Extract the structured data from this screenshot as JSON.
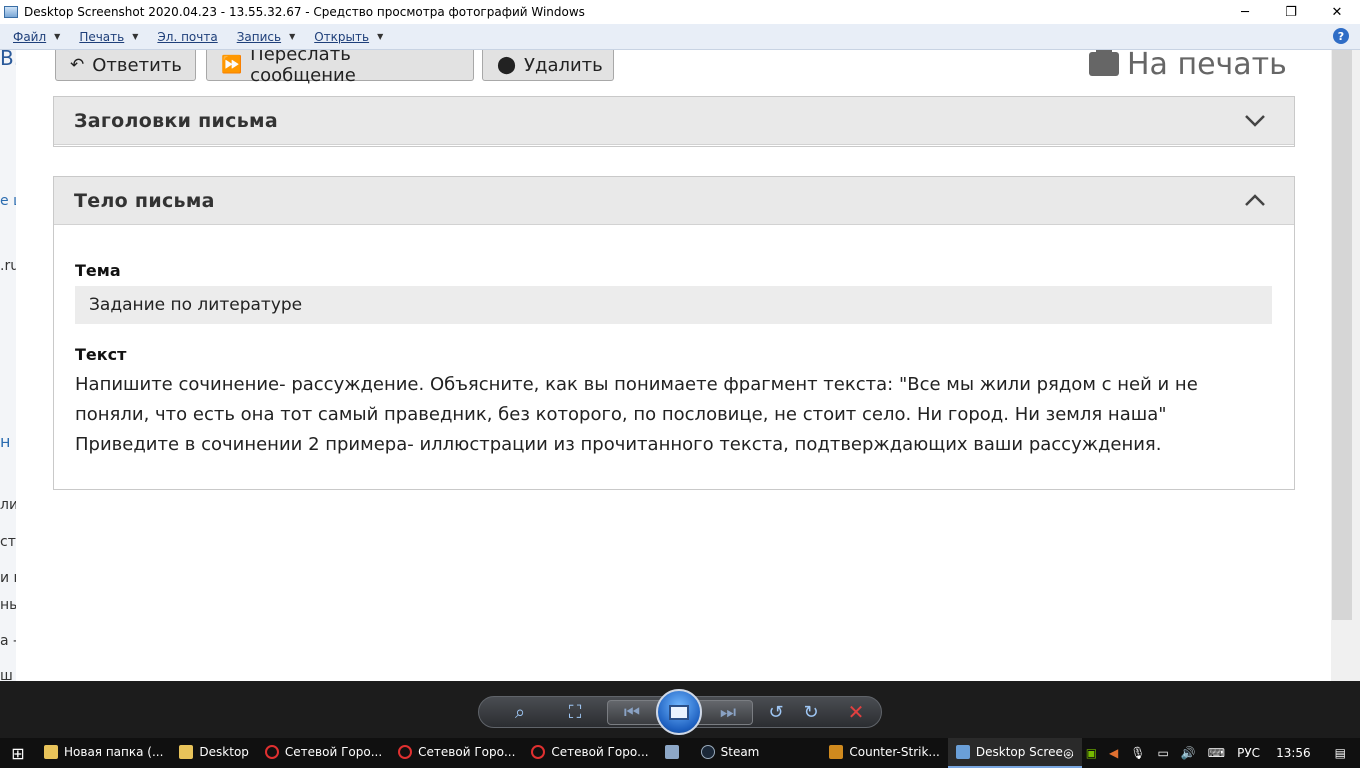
{
  "window": {
    "title": "Desktop Screenshot 2020.04.23 - 13.55.32.67 - Средство просмотра фотографий Windows",
    "controls": {
      "minimize": "─",
      "maximize": "❐",
      "close": "✕"
    }
  },
  "menu": [
    {
      "label": "Файл",
      "has_dropdown": true
    },
    {
      "label": "Печать",
      "has_dropdown": true
    },
    {
      "label": "Эл. почта",
      "has_dropdown": false
    },
    {
      "label": "Запись",
      "has_dropdown": true
    },
    {
      "label": "Открыть",
      "has_dropdown": true
    }
  ],
  "help": "?",
  "left_fragments": [
    "В.",
    "е ц",
    ".ru",
    "н",
    "ли",
    "ст",
    "и г",
    "нь",
    "а -",
    "ш"
  ],
  "email": {
    "actions": {
      "reply": "Ответить",
      "forward": "Переслать сообщение",
      "delete": "Удалить",
      "print": "На печать"
    },
    "headers_section": {
      "title": "Заголовки письма",
      "expanded": false
    },
    "body_section": {
      "title": "Тело письма",
      "expanded": true
    },
    "subject_label": "Тема",
    "subject_value": "Задание по литературе",
    "text_label": "Текст",
    "text_lines": [
      "Напишите сочинение- рассуждение. Объясните, как вы понимаете фрагмент текста: \"Все мы жили рядом с ней и не",
      "поняли, что есть она тот самый праведник, без которого, по пословице, не стоит село. Ни город.  Ни земля наша\"",
      "Приведите в сочинении 2 примера- иллюстрации из прочитанного текста, подтверждающих ваши рассуждения."
    ]
  },
  "taskbar": {
    "items": [
      {
        "label": "Новая папка (...",
        "icon": "folder-icon"
      },
      {
        "label": "Desktop",
        "icon": "folder-icon"
      },
      {
        "label": "Сетевой Горо...",
        "icon": "opera-icon"
      },
      {
        "label": "Сетевой Горо...",
        "icon": "opera-icon"
      },
      {
        "label": "Сетевой Горо...",
        "icon": "opera-icon"
      },
      {
        "label": "",
        "icon": "app-icon"
      },
      {
        "label": "Steam",
        "icon": "steam-icon"
      },
      {
        "label": "Counter-Strik...",
        "icon": "cs-icon"
      },
      {
        "label": "Desktop Scree...",
        "icon": "photo-viewer-icon",
        "active": true
      }
    ],
    "language": "РУС",
    "time": "13:56"
  },
  "colors": {
    "link": "#1e3f7a",
    "panel_head": "#e9e9e9",
    "accent": "#2f6dc6"
  }
}
